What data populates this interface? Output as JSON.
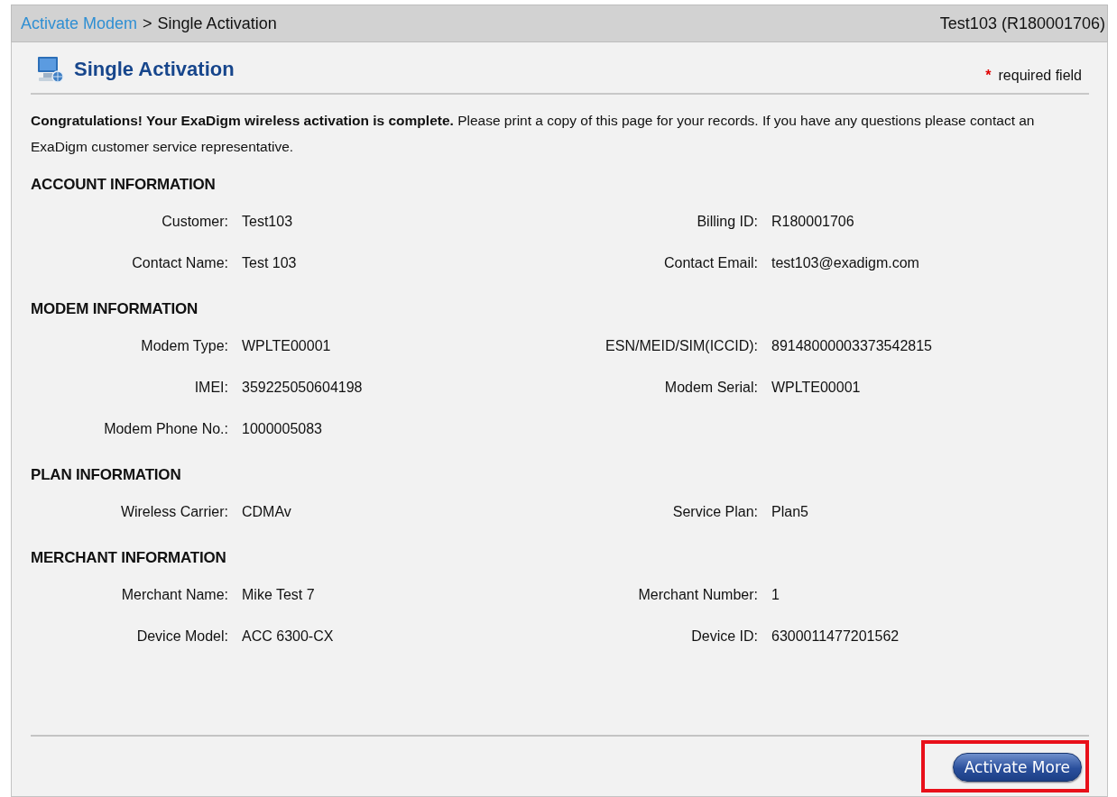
{
  "breadcrumb": {
    "link": "Activate Modem",
    "separator": ">",
    "current": "Single Activation"
  },
  "account_label": "Test103 (R180001706)",
  "page_title": "Single Activation",
  "required_note": {
    "mark": "*",
    "text": "required field"
  },
  "message": "**Congratulations! Your ExaDigm wireless activation is complete.** Please print a copy of this page for your records. If you have any questions please contact an ExaDigm customer service representative.",
  "sections": [
    {
      "heading": "ACCOUNT INFORMATION",
      "rows": [
        [
          {
            "label": "Customer:",
            "value": "Test103"
          },
          {
            "label": "Billing ID:",
            "value": "R180001706"
          }
        ],
        [
          {
            "label": "Contact Name:",
            "value": "Test 103"
          },
          {
            "label": "Contact Email:",
            "value": "test103@exadigm.com"
          }
        ]
      ]
    },
    {
      "heading": "MODEM INFORMATION",
      "rows": [
        [
          {
            "label": "Modem Type:",
            "value": "WPLTE00001"
          },
          {
            "label": "ESN/MEID/SIM(ICCID):",
            "value": "89148000003373542815"
          }
        ],
        [
          {
            "label": "IMEI:",
            "value": "359225050604198"
          },
          {
            "label": "Modem Serial:",
            "value": "WPLTE00001"
          }
        ],
        [
          {
            "label": "Modem Phone No.:",
            "value": "1000005083"
          }
        ]
      ]
    },
    {
      "heading": "PLAN INFORMATION",
      "rows": [
        [
          {
            "label": "Wireless Carrier:",
            "value": "CDMAv"
          },
          {
            "label": "Service Plan:",
            "value": "Plan5"
          }
        ]
      ]
    },
    {
      "heading": "MERCHANT INFORMATION",
      "rows": [
        [
          {
            "label": "Merchant Name:",
            "value": "Mike Test 7"
          },
          {
            "label": "Merchant Number:",
            "value": "1"
          }
        ],
        [
          {
            "label": "Device Model:",
            "value": "ACC 6300-CX"
          },
          {
            "label": "Device ID:",
            "value": "6300011477201562"
          }
        ]
      ]
    }
  ],
  "button": {
    "label": "Activate More",
    "highlighted": true
  }
}
